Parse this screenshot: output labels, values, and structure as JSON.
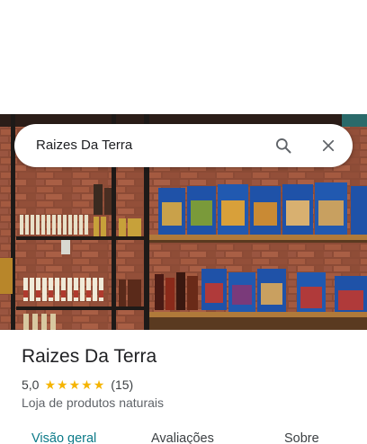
{
  "search": {
    "query": "Raizes Da Terra"
  },
  "place": {
    "name": "Raizes Da Terra",
    "rating": "5,0",
    "stars": 5,
    "review_count": "(15)",
    "category": "Loja de produtos naturais"
  },
  "tabs": [
    {
      "label": "Visão geral",
      "active": true
    },
    {
      "label": "Avaliações",
      "active": false
    },
    {
      "label": "Sobre",
      "active": false
    }
  ],
  "colors": {
    "accent": "#0b7a88",
    "star": "#f5b400",
    "brick": "#8a4a35"
  },
  "icons": {
    "search": "search-icon",
    "close": "close-icon",
    "star": "star-icon"
  }
}
